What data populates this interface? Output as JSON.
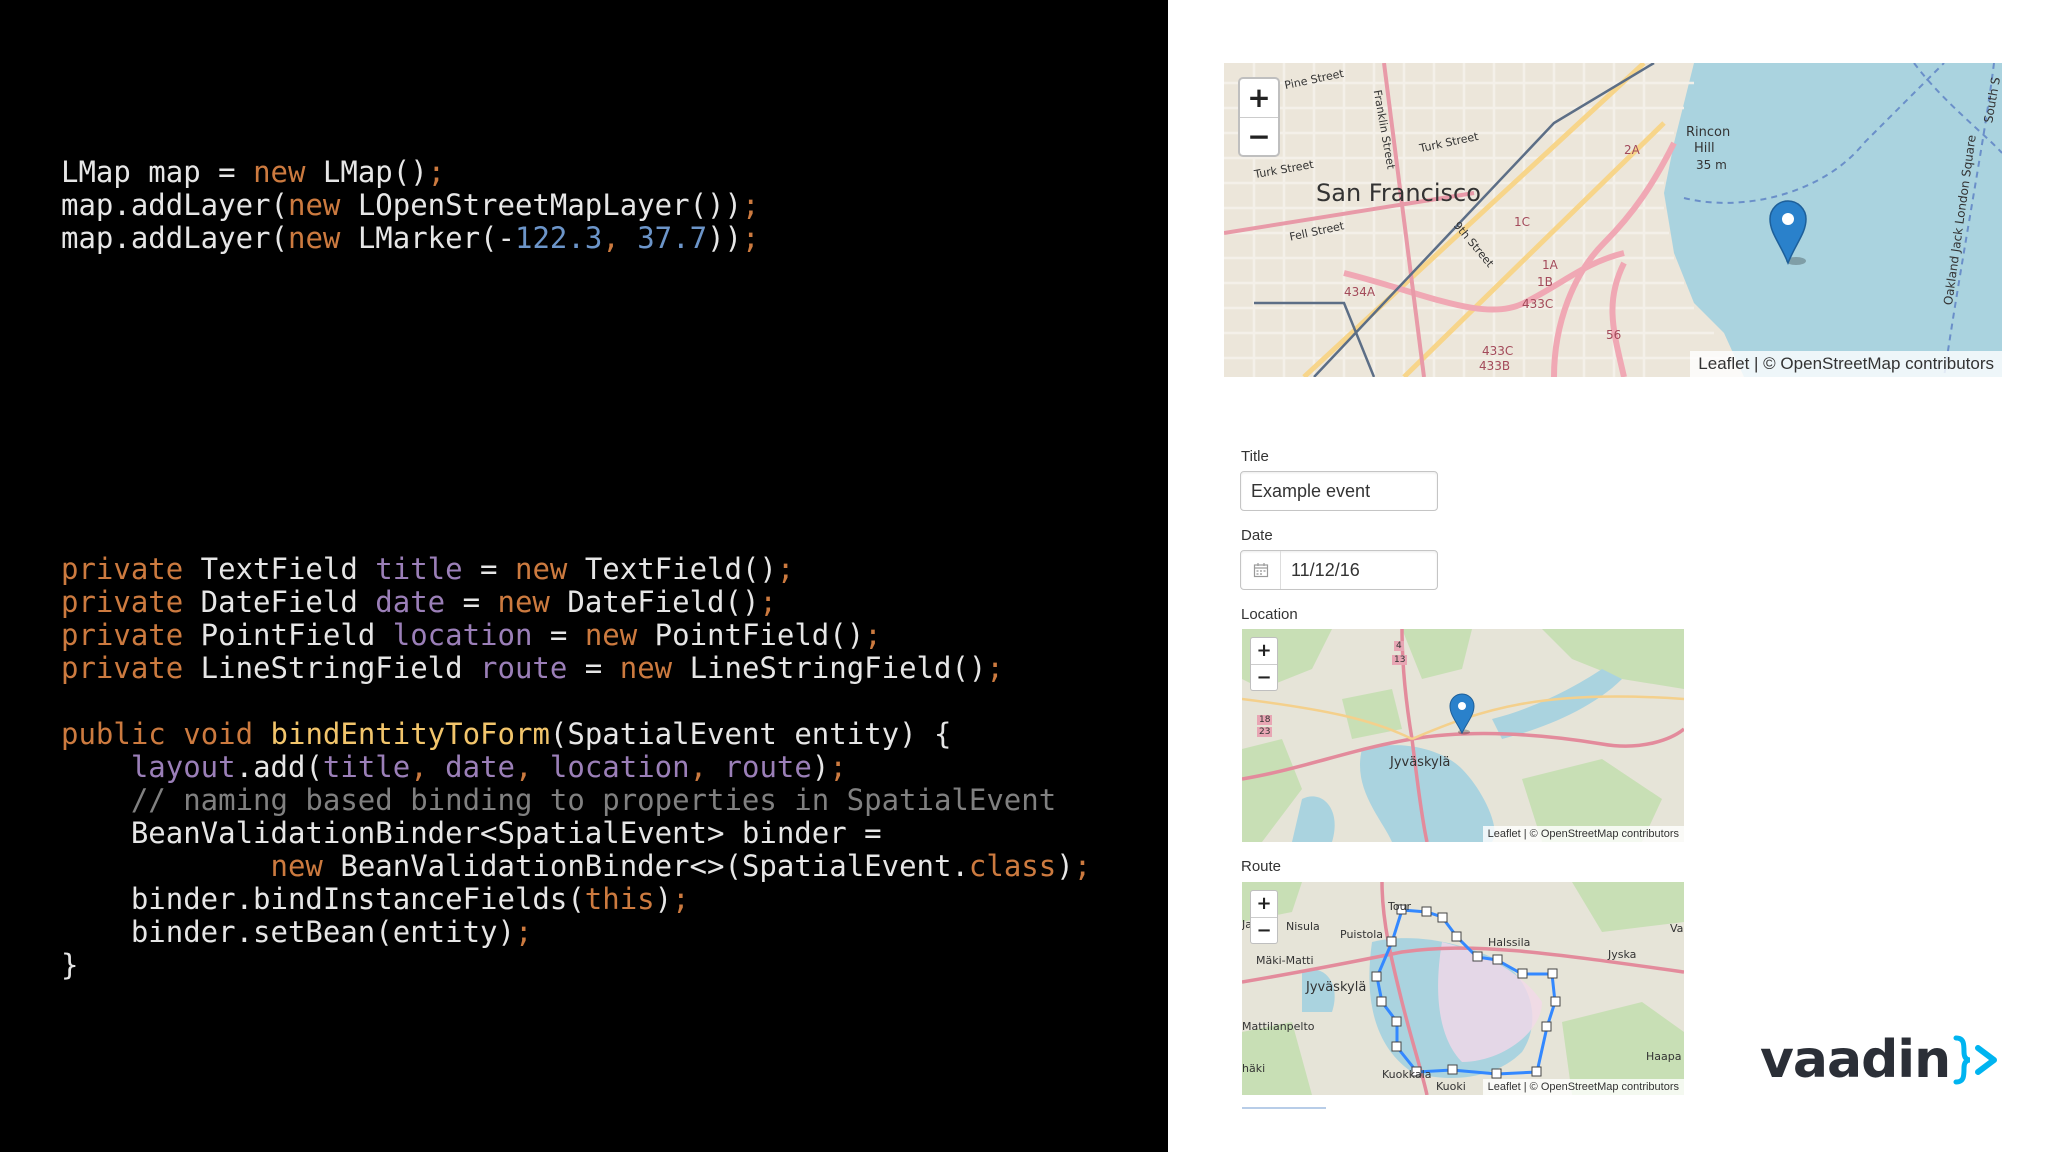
{
  "code": {
    "block1": [
      [
        [
          "LMap map = ",
          "pl"
        ],
        [
          "new",
          "kw"
        ],
        [
          " LMap()",
          "pl"
        ],
        [
          ";",
          "kw"
        ]
      ],
      [
        [
          "map.addLayer(",
          "pl"
        ],
        [
          "new",
          "kw"
        ],
        [
          " LOpenStreetMapLayer())",
          "pl"
        ],
        [
          ";",
          "kw"
        ]
      ],
      [
        [
          "map.addLayer(",
          "pl"
        ],
        [
          "new",
          "kw"
        ],
        [
          " LMarker(-",
          "pl"
        ],
        [
          "122.3",
          "num"
        ],
        [
          ", ",
          "kw"
        ],
        [
          "37.7",
          "num"
        ],
        [
          "))",
          "pl"
        ],
        [
          ";",
          "kw"
        ]
      ]
    ],
    "block2": [
      [
        [
          "private",
          "kw"
        ],
        [
          " TextField ",
          "pl"
        ],
        [
          "title",
          "field"
        ],
        [
          " = ",
          "pl"
        ],
        [
          "new",
          "kw"
        ],
        [
          " TextField()",
          "pl"
        ],
        [
          ";",
          "kw"
        ]
      ],
      [
        [
          "private",
          "kw"
        ],
        [
          " DateField ",
          "pl"
        ],
        [
          "date",
          "field"
        ],
        [
          " = ",
          "pl"
        ],
        [
          "new",
          "kw"
        ],
        [
          " DateField()",
          "pl"
        ],
        [
          ";",
          "kw"
        ]
      ],
      [
        [
          "private",
          "kw"
        ],
        [
          " PointField ",
          "pl"
        ],
        [
          "location",
          "field"
        ],
        [
          " = ",
          "pl"
        ],
        [
          "new",
          "kw"
        ],
        [
          " PointField()",
          "pl"
        ],
        [
          ";",
          "kw"
        ]
      ],
      [
        [
          "private",
          "kw"
        ],
        [
          " LineStringField ",
          "pl"
        ],
        [
          "route",
          "field"
        ],
        [
          " = ",
          "pl"
        ],
        [
          "new",
          "kw"
        ],
        [
          " LineStringField()",
          "pl"
        ],
        [
          ";",
          "kw"
        ]
      ],
      [
        [
          "",
          "pl"
        ]
      ],
      [
        [
          "public",
          "kw"
        ],
        [
          " ",
          "pl"
        ],
        [
          "void",
          "kw"
        ],
        [
          " ",
          "pl"
        ],
        [
          "bindEntityToForm",
          "fn"
        ],
        [
          "(SpatialEvent entity) {",
          "pl"
        ]
      ],
      [
        [
          "    ",
          "pl"
        ],
        [
          "layout",
          "field"
        ],
        [
          ".add(",
          "pl"
        ],
        [
          "title",
          "field"
        ],
        [
          ", ",
          "kw"
        ],
        [
          "date",
          "field"
        ],
        [
          ", ",
          "kw"
        ],
        [
          "location",
          "field"
        ],
        [
          ", ",
          "kw"
        ],
        [
          "route",
          "field"
        ],
        [
          ")",
          "pl"
        ],
        [
          ";",
          "kw"
        ]
      ],
      [
        [
          "    // naming based binding to properties in SpatialEvent",
          "cm"
        ]
      ],
      [
        [
          "    BeanValidationBinder<SpatialEvent> binder =",
          "pl"
        ]
      ],
      [
        [
          "            ",
          "pl"
        ],
        [
          "new",
          "kw"
        ],
        [
          " BeanValidationBinder<>(SpatialEvent.",
          "pl"
        ],
        [
          "class",
          "kw"
        ],
        [
          ")",
          "pl"
        ],
        [
          ";",
          "kw"
        ]
      ],
      [
        [
          "    binder.bindInstanceFields(",
          "pl"
        ],
        [
          "this",
          "kw"
        ],
        [
          ")",
          "pl"
        ],
        [
          ";",
          "kw"
        ]
      ],
      [
        [
          "    binder.setBean(entity)",
          "pl"
        ],
        [
          ";",
          "kw"
        ]
      ],
      [
        [
          "}",
          "pl"
        ]
      ]
    ]
  },
  "main_map": {
    "zoom_in": "+",
    "zoom_out": "−",
    "attribution": "Leaflet | © OpenStreetMap contributors",
    "labels": {
      "city": "San Francisco",
      "pine": "Pine Street",
      "franklin": "Franklin Street",
      "turk1": "Turk Street",
      "turk2": "Turk Street",
      "fell": "Fell Street",
      "ninth": "9th Street",
      "rincon": "Rincon",
      "hill": "Hill",
      "height": "35 m",
      "oakland": "Oakland Jack London Square",
      "south": "South S",
      "s2a": "2A",
      "s1c": "1C",
      "s1a": "1A",
      "s1b": "1B",
      "s433c": "433C",
      "s434a": "434A",
      "s433c2": "433C",
      "s433b": "433B",
      "s56": "56"
    }
  },
  "form": {
    "title_label": "Title",
    "title_value": "Example event",
    "date_label": "Date",
    "date_value": "11/12/16",
    "location_label": "Location",
    "route_label": "Route"
  },
  "location_map": {
    "zoom_in": "+",
    "zoom_out": "−",
    "attribution": "Leaflet | © OpenStreetMap contributors",
    "labels": {
      "city": "Jyväskylä",
      "r4": "4",
      "r13": "13",
      "r18": "18",
      "r23": "23"
    }
  },
  "route_map": {
    "zoom_in": "+",
    "zoom_out": "−",
    "attribution": "Leaflet | © OpenStreetMap contributors",
    "labels": {
      "nisula": "Nisula",
      "puistola": "Puistola",
      "tourula": "Tour",
      "halssila": "Halssila",
      "jyska": "Jyska",
      "makimatti": "Mäki-Matti",
      "jyvaskyla": "Jyväskylä",
      "mattilanpelto": "Mattilanpelto",
      "haapa": "Haapa",
      "kuokkala": "Kuokkala",
      "kuoki": "Kuoki",
      "haki": "häki",
      "ja": "Ja",
      "va": "Va"
    }
  },
  "logo": {
    "text": "vaadin",
    "mark": "}>",
    "mark_color": "#00b4f0",
    "text_color": "#2b2f37"
  }
}
